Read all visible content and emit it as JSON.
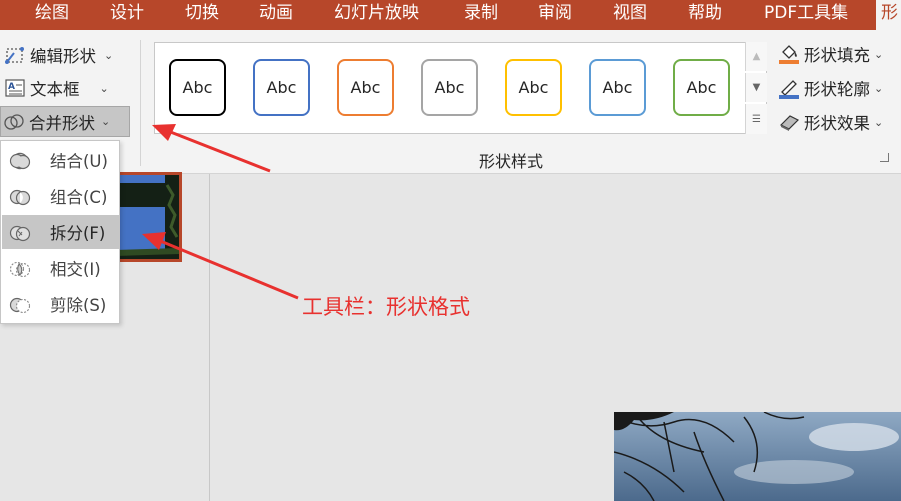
{
  "tabs": [
    {
      "label": "绘图"
    },
    {
      "label": "设计"
    },
    {
      "label": "切换"
    },
    {
      "label": "动画"
    },
    {
      "label": "幻灯片放映"
    },
    {
      "label": "录制"
    },
    {
      "label": "审阅"
    },
    {
      "label": "视图"
    },
    {
      "label": "帮助"
    },
    {
      "label": "PDF工具集"
    },
    {
      "label": "形"
    }
  ],
  "insert_group": {
    "edit_shape": "编辑形状",
    "text_box": "文本框",
    "merge_shapes": "合并形状"
  },
  "shape_styles": {
    "group_label": "形状样式",
    "swatch_text": "Abc",
    "swatch_colors": [
      "#000000",
      "#4472c4",
      "#ed7d31",
      "#a5a5a5",
      "#ffc000",
      "#5b9bd5",
      "#70ad47"
    ],
    "fill": "形状填充",
    "outline": "形状轮廓",
    "effects": "形状效果"
  },
  "merge_menu": [
    {
      "label": "结合(U)",
      "highlighted": false
    },
    {
      "label": "组合(C)",
      "highlighted": false
    },
    {
      "label": "拆分(F)",
      "highlighted": true
    },
    {
      "label": "相交(I)",
      "highlighted": false
    },
    {
      "label": "剪除(S)",
      "highlighted": false
    }
  ],
  "annotation": "工具栏：形状格式",
  "colors": {
    "ribbon_tab_bar": "#b7472a",
    "annotation_red": "#e8312f",
    "fill_accent": "#ed7d31",
    "outline_accent": "#4472c4"
  }
}
